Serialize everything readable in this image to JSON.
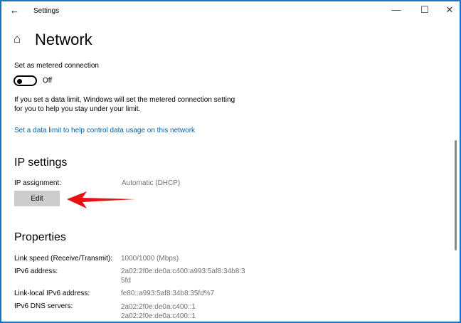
{
  "window": {
    "title": "Settings",
    "back": "←",
    "minimize": "—",
    "maximize": "☐",
    "close": "✕"
  },
  "page": {
    "title": "Network",
    "home_icon": "⌂"
  },
  "metered": {
    "label": "Set as metered connection",
    "state": "Off",
    "info_line1": "If you set a data limit, Windows will set the metered connection setting",
    "info_line2": "for you to help you stay under your limit.",
    "link": "Set a data limit to help control data usage on this network"
  },
  "ip": {
    "heading": "IP settings",
    "label": "IP assignment:",
    "value": "Automatic (DHCP)",
    "edit": "Edit"
  },
  "properties": {
    "heading": "Properties",
    "rows": [
      {
        "label": "Link speed (Receive/Transmit):",
        "value": "1000/1000 (Mbps)"
      },
      {
        "label": "IPv6 address:",
        "value": "2a02:2f0e:de0a:c400:a993:5af8:34b8:3",
        "value2": "5fd"
      },
      {
        "label": "Link-local IPv6 address:",
        "value": "fe80::a993:5af8:34b8:35fd%7"
      },
      {
        "label": "IPv6 DNS servers:",
        "value": "2a02:2f0e:de0a:c400::1",
        "value2": "2a02:2f0e:de0a:c400::1"
      }
    ]
  },
  "colors": {
    "accent": "#0063b1",
    "arrow": "#e81010"
  }
}
